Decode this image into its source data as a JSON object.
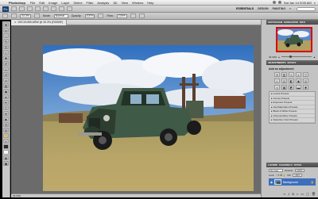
{
  "menubar": {
    "app": "Photoshop",
    "items": [
      "File",
      "Edit",
      "Image",
      "Layer",
      "Select",
      "Filter",
      "Analysis",
      "3D",
      "View",
      "Window",
      "Help"
    ],
    "clock": "Sat Jan 14  5:55 AM"
  },
  "appbar": {
    "logo": "Ps",
    "workspaces": [
      "ESSENTIALS",
      "DESIGN",
      "PAINTING"
    ],
    "active_workspace": "ESSENTIALS",
    "more": "»"
  },
  "options": {
    "zoom": "33.3%",
    "mode_label": "Mode:",
    "mode": "Normal",
    "opacity_label": "Opacity:",
    "opacity": "100%",
    "flow_label": "Flow:",
    "flow": "100%"
  },
  "document": {
    "tab_title": "DSC01089.ARW @ 33.3% (RGB/8*)",
    "zoom": "33.33%"
  },
  "right_panels": {
    "top_tabs": [
      "HISTOGRAM",
      "NAVIGATOR",
      "INFO"
    ],
    "selected_top": "NAVIGATOR",
    "nav_zoom": "33.33%",
    "mid_tabs": [
      "ADJUSTMENTS",
      "MASKS"
    ],
    "selected_mid": "ADJUSTMENTS",
    "adj_title": "Add an adjustment",
    "presets": [
      "Levels Presets",
      "Curves Presets",
      "Exposure Presets",
      "Hue/Saturation Presets",
      "Black & White Presets",
      "Channel Mixer Presets",
      "Selective Color Presets"
    ],
    "layer_tabs": [
      "LAYERS",
      "CHANNELS",
      "PATHS"
    ],
    "selected_layer_tab": "LAYERS",
    "blend": "Normal",
    "opacity_label": "Opacity:",
    "opacity": "100%",
    "lock_label": "Lock:",
    "fill_label": "Fill:",
    "fill": "100%",
    "layer_name": "Background"
  },
  "colors": {
    "sky": "#4f86c8",
    "truck": "#3f5a46",
    "grass": "#b8a463",
    "ps_blue": "#1f3f6e",
    "selection": "#3d6ebd"
  }
}
